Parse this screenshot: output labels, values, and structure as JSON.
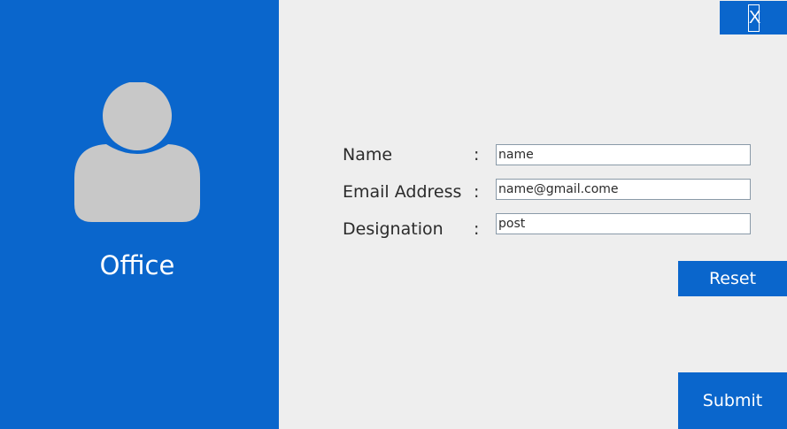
{
  "window": {
    "close_label": "X"
  },
  "profile": {
    "avatar_icon": "user-silhouette-icon",
    "company_name": "Office"
  },
  "form": {
    "fields": [
      {
        "label": "Name",
        "separator": ":",
        "value": "name"
      },
      {
        "label": "Email Address",
        "separator": ":",
        "value": "name@gmail.come"
      },
      {
        "label": "Designation",
        "separator": ":",
        "value": "post"
      }
    ]
  },
  "actions": {
    "reset_label": "Reset",
    "submit_label": "Submit"
  },
  "colors": {
    "accent": "#0a66cc",
    "background": "#eeeeee",
    "avatar": "#c8c8c8",
    "text": "#2b2b2b"
  }
}
